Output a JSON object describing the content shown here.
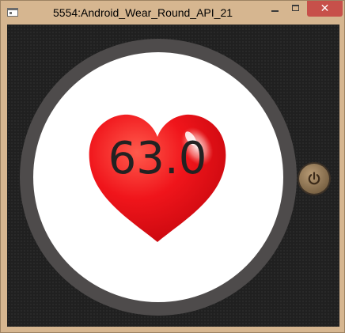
{
  "window": {
    "title": "5554:Android_Wear_Round_API_21",
    "controls": {
      "minimize_icon": "minimize-icon",
      "maximize_icon": "maximize-icon",
      "close_label": "✕"
    }
  },
  "watch": {
    "heart_rate": "63.0",
    "heart_icon": "heart-icon",
    "heart_color": "#e8101a"
  },
  "side_buttons": {
    "power_icon": "power-icon"
  },
  "colors": {
    "window_frame": "#d6b690",
    "close_button": "#c7504a",
    "emulator_bg": "#202020",
    "bezel": "#4e4b4b",
    "screen": "#ffffff"
  }
}
